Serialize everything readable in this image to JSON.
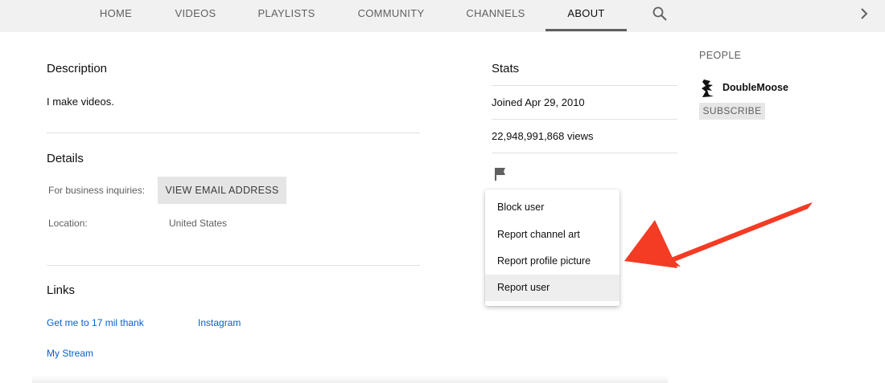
{
  "tabs": [
    {
      "label": "HOME",
      "active": false
    },
    {
      "label": "VIDEOS",
      "active": false
    },
    {
      "label": "PLAYLISTS",
      "active": false
    },
    {
      "label": "COMMUNITY",
      "active": false
    },
    {
      "label": "CHANNELS",
      "active": false
    },
    {
      "label": "ABOUT",
      "active": true
    }
  ],
  "icons": {
    "search": "search-icon",
    "next": "chevron-right-icon",
    "report": "flag-icon",
    "avatar": "avatar-icon"
  },
  "description": {
    "title": "Description",
    "text": "I make videos."
  },
  "details": {
    "title": "Details",
    "business_label": "For business inquiries:",
    "email_button": "VIEW EMAIL ADDRESS",
    "location_label": "Location:",
    "location_value": "United States"
  },
  "links": {
    "title": "Links",
    "items": [
      "Get me to 17 mil thank",
      "Instagram",
      "My Stream"
    ]
  },
  "stats": {
    "title": "Stats",
    "joined": "Joined Apr 29, 2010",
    "views": "22,948,991,868 views"
  },
  "report_menu": {
    "items": [
      "Block user",
      "Report channel art",
      "Report profile picture",
      "Report user"
    ],
    "highlighted": "Report user"
  },
  "people": {
    "title": "PEOPLE",
    "name": "DoubleMoose",
    "subscribe_label": "SUBSCRIBE"
  },
  "colors": {
    "annotation_arrow": "#f43b24",
    "link": "#065fd4"
  }
}
